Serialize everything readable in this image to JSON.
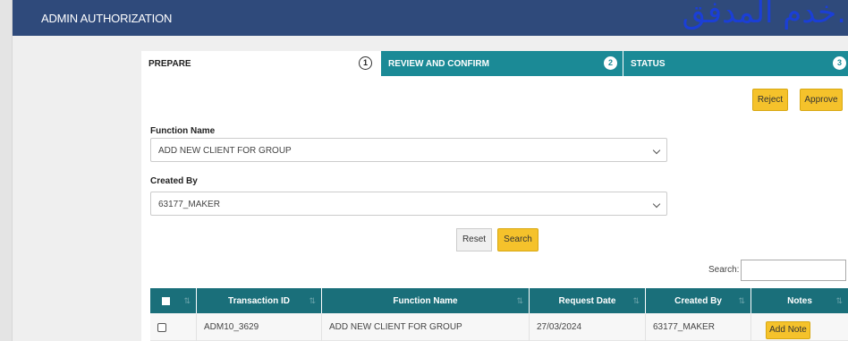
{
  "header": {
    "title": "ADMIN AUTHORIZATION",
    "overlay_text": "خدم المدفق."
  },
  "steps": [
    {
      "label": "PREPARE",
      "number": "1"
    },
    {
      "label": "REVIEW AND CONFIRM",
      "number": "2"
    },
    {
      "label": "STATUS",
      "number": "3"
    }
  ],
  "actions": {
    "reject": "Reject",
    "approve": "Approve"
  },
  "form": {
    "function_name_label": "Function Name",
    "function_name_value": "ADD NEW CLIENT FOR GROUP",
    "created_by_label": "Created By",
    "created_by_value": "63177_MAKER",
    "reset": "Reset",
    "search": "Search"
  },
  "table": {
    "search_label": "Search:",
    "search_value": "",
    "columns": [
      "Transaction ID",
      "Function Name",
      "Request Date",
      "Created By",
      "Notes"
    ],
    "rows": [
      {
        "transaction_id": "ADM10_3629",
        "function_name": "ADD NEW CLIENT FOR GROUP",
        "request_date": "27/03/2024",
        "created_by": "63177_MAKER",
        "notes": "Add Note"
      }
    ]
  },
  "colors": {
    "header": "#2f4a7b",
    "step_active": "#1b8a96",
    "table_header": "#1a6f7a",
    "button": "#f5c22b"
  }
}
